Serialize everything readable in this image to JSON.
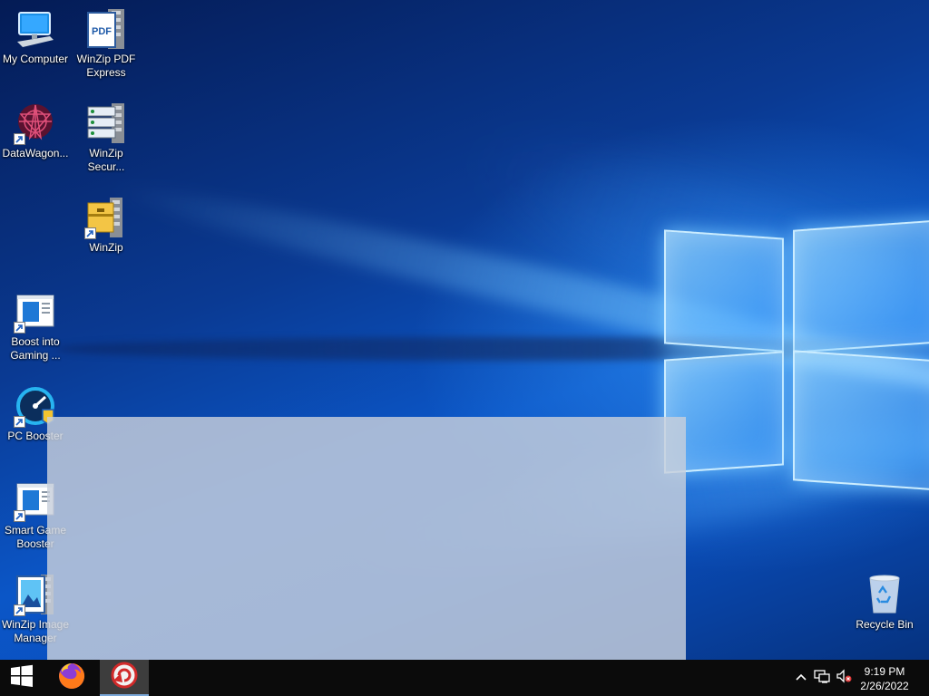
{
  "desktop": {
    "icons": [
      {
        "label": "My Computer"
      },
      {
        "label": "WinZip PDF Express"
      },
      {
        "label": "DataWagon..."
      },
      {
        "label": "WinZip Secur..."
      },
      {
        "label": "WinZip"
      },
      {
        "label": "Boost into Gaming ..."
      },
      {
        "label": "PC Booster"
      },
      {
        "label": "Smart Game Booster"
      },
      {
        "label": "WinZip Image Manager"
      },
      {
        "label": "Recycle Bin"
      }
    ]
  },
  "taskbar": {
    "start_icon": "windows-logo-icon",
    "pinned": [
      {
        "name": "firefox-icon"
      },
      {
        "name": "game-booster-app-icon",
        "active": true
      }
    ],
    "tray": {
      "show_hidden_icon": "chevron-up-icon",
      "network_icon": "network-icon",
      "volume_icon": "volume-muted-icon"
    },
    "clock": {
      "time": "9:19 PM",
      "date": "2/26/2022"
    }
  }
}
